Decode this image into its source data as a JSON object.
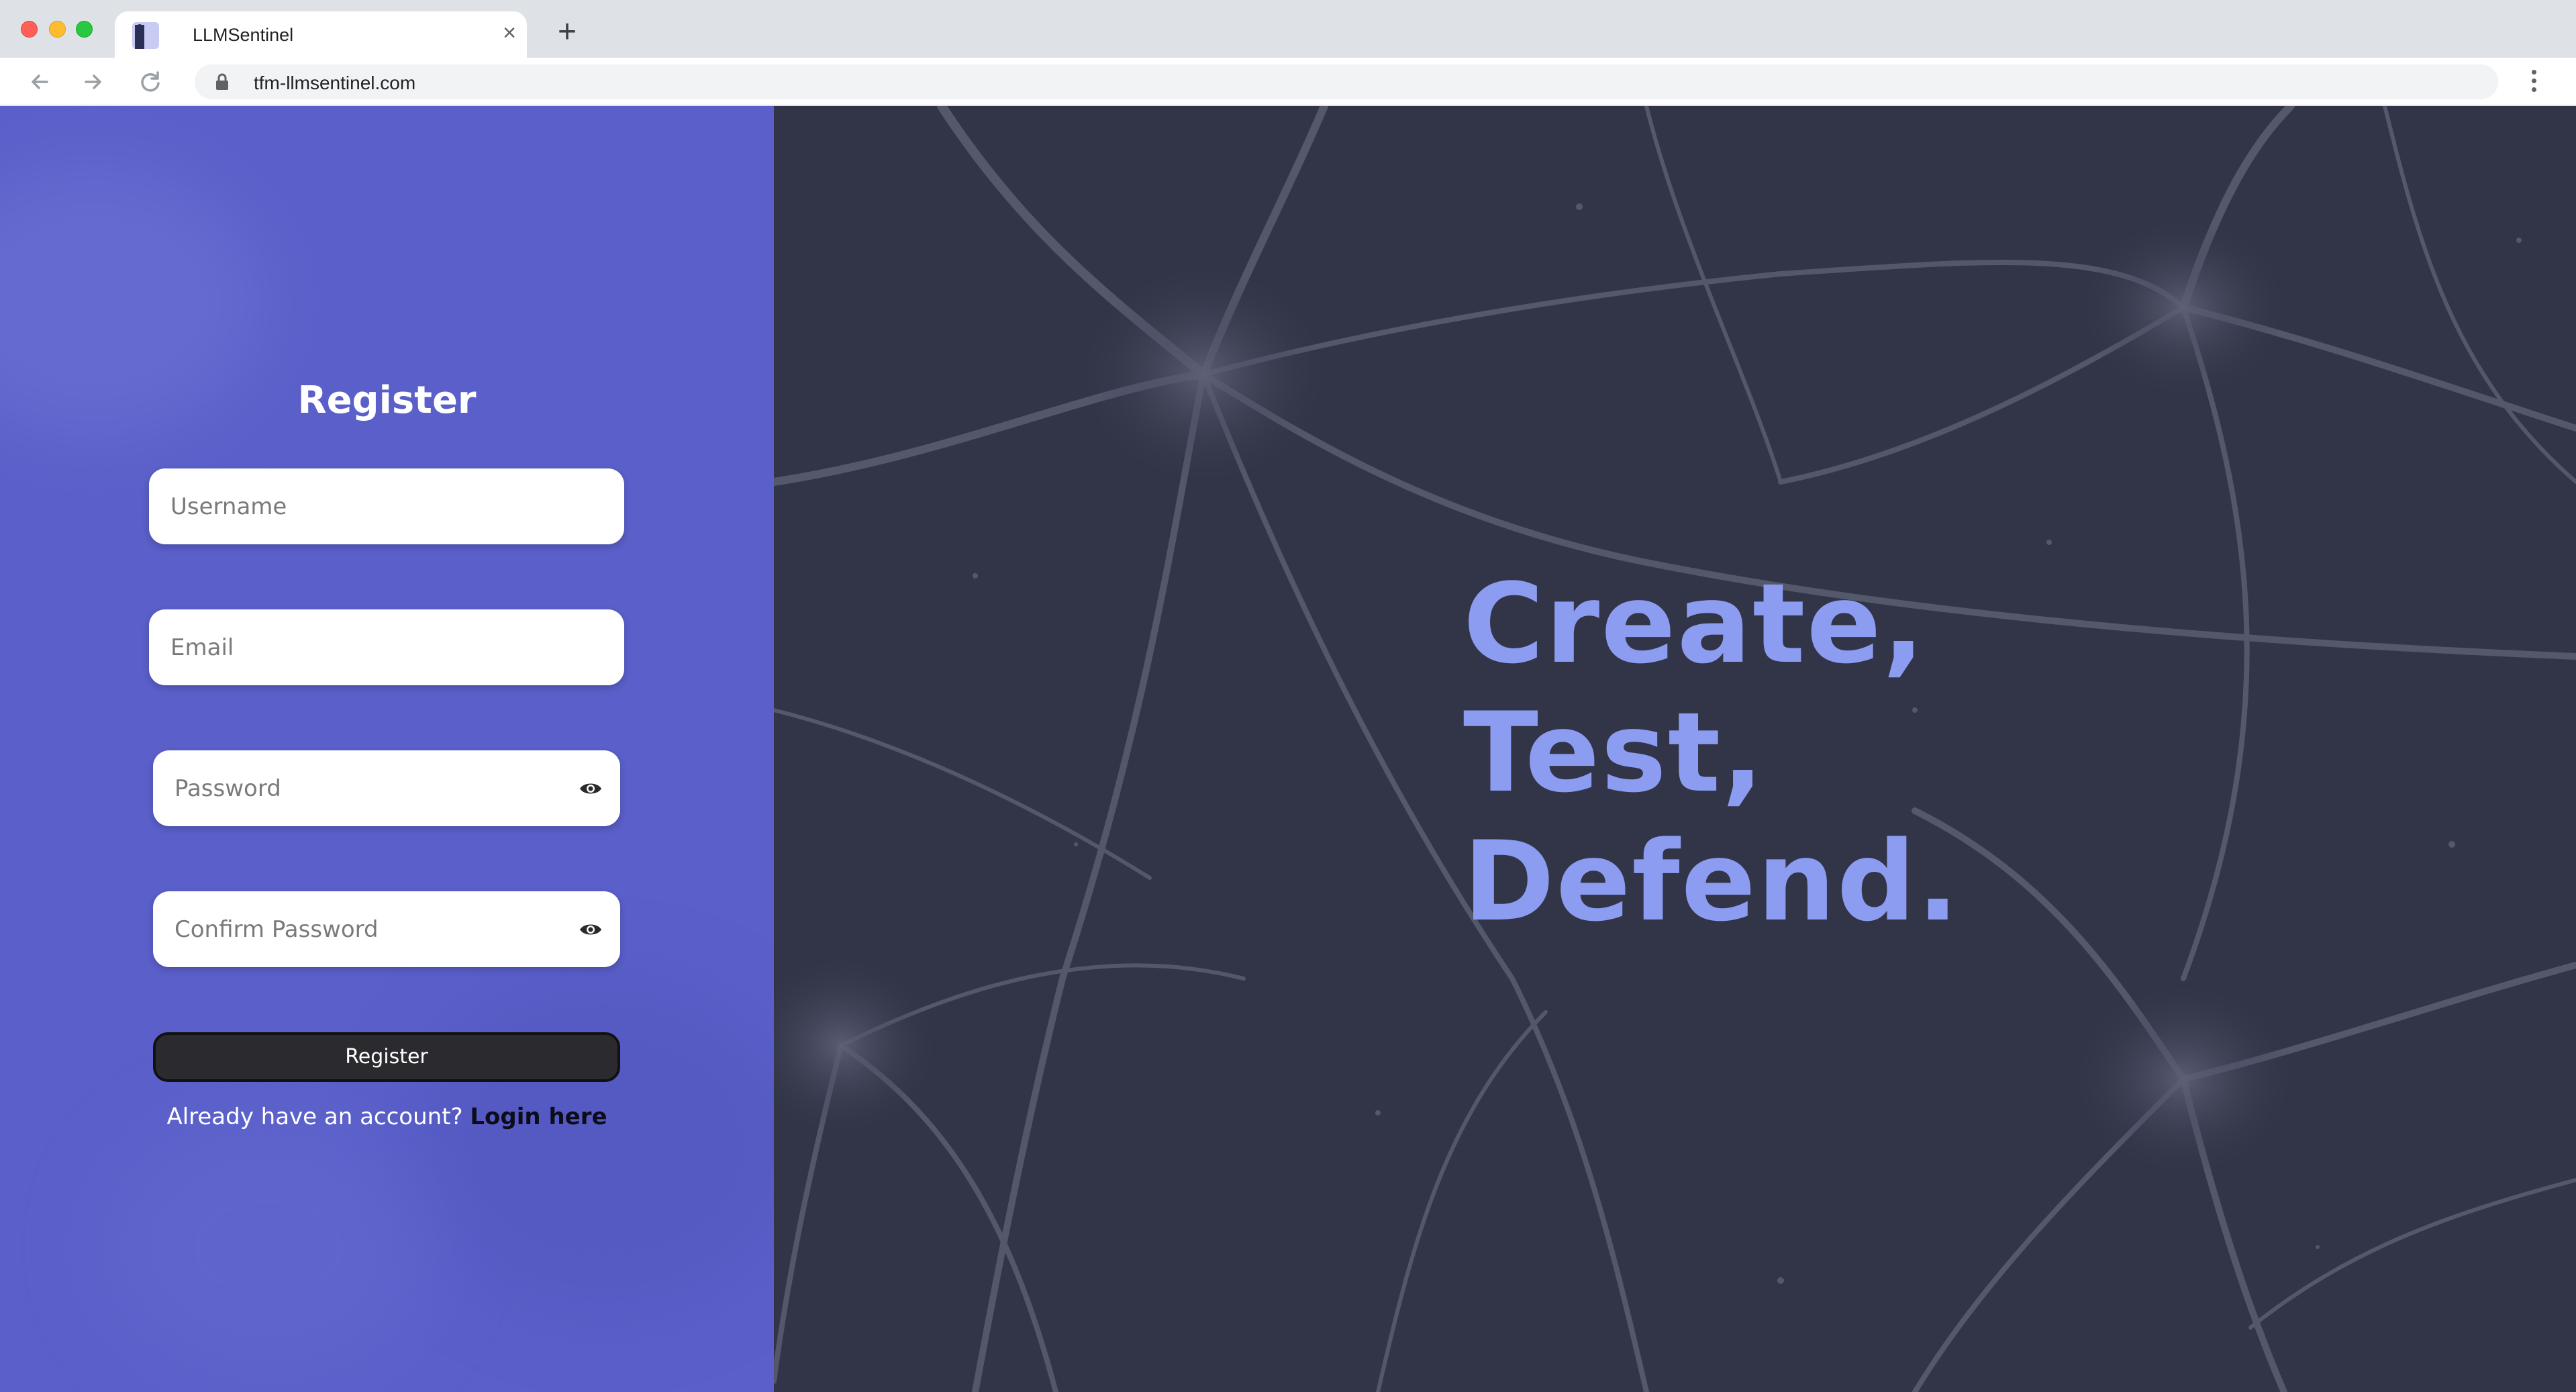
{
  "browser": {
    "tab_title": "LLMSentinel",
    "url": "tfm-llmsentinel.com",
    "icons": {
      "back": "arrow-left-icon",
      "forward": "arrow-right-icon",
      "reload": "reload-icon",
      "lock": "lock-icon",
      "menu": "kebab-menu-icon",
      "close": "close-icon",
      "new_tab": "plus-icon"
    }
  },
  "register_form": {
    "title": "Register",
    "username": {
      "placeholder": "Username",
      "value": ""
    },
    "email": {
      "placeholder": "Email",
      "value": ""
    },
    "password": {
      "placeholder": "Password",
      "value": "",
      "toggle_icon": "eye-icon"
    },
    "confirm_password": {
      "placeholder": "Confirm Password",
      "value": "",
      "toggle_icon": "eye-icon"
    },
    "submit_label": "Register",
    "login_prompt": "Already have an account?",
    "login_link": "Login here"
  },
  "hero": {
    "lines": [
      "Create,",
      "Test,",
      "Defend."
    ]
  },
  "colors": {
    "left_panel": "#5a5fc9",
    "right_panel": "#323548",
    "slogan": "#8c9cf0",
    "button": "#2b2b2f"
  }
}
